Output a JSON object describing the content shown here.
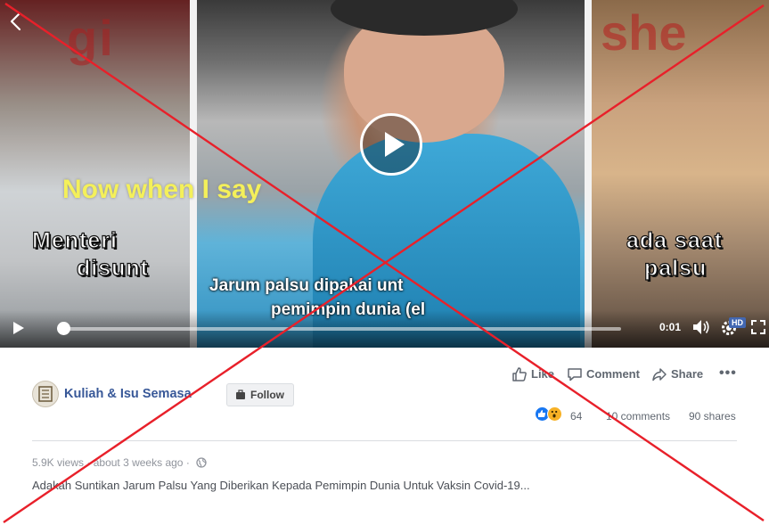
{
  "video": {
    "left_top_text": "gi",
    "right_top_text": "she",
    "center_english_caption": "Now when I say",
    "subtitle_line1": "Jarum palsu dipakai unt",
    "subtitle_line2": "pemimpin dunia (el",
    "left_caption_line1": "Menteri",
    "left_caption_line2": "disunt",
    "right_caption_line1": "ada saat",
    "right_caption_line2": "palsu",
    "time": "0:01",
    "hd_badge": "HD",
    "progress": 0.0
  },
  "post": {
    "page_name": "Kuliah & Isu Semasa",
    "follow_label": "Follow",
    "actions": {
      "like_label": "Like",
      "comment_label": "Comment",
      "share_label": "Share",
      "more_label": "•••"
    },
    "reaction_count": "64",
    "comments": "10 comments",
    "shares": "90 shares",
    "views": "5.9K views",
    "separator": "·",
    "time_ago": "about 3 weeks ago",
    "separator2": "·",
    "caption": "Adakah Suntikan Jarum Palsu Yang Diberikan Kepada Pemimpin Dunia Untuk Vaksin Covid-19..."
  },
  "icons": {
    "back": "chevron-left-icon",
    "play": "play-icon",
    "volume": "volume-icon",
    "settings": "gear-icon",
    "fullscreen": "fullscreen-icon",
    "globe": "globe-icon"
  },
  "colors": {
    "link_blue": "#385898",
    "like_blue": "#1877f2",
    "wow_yellow": "#f7b125",
    "cross_red": "#e8202a"
  }
}
